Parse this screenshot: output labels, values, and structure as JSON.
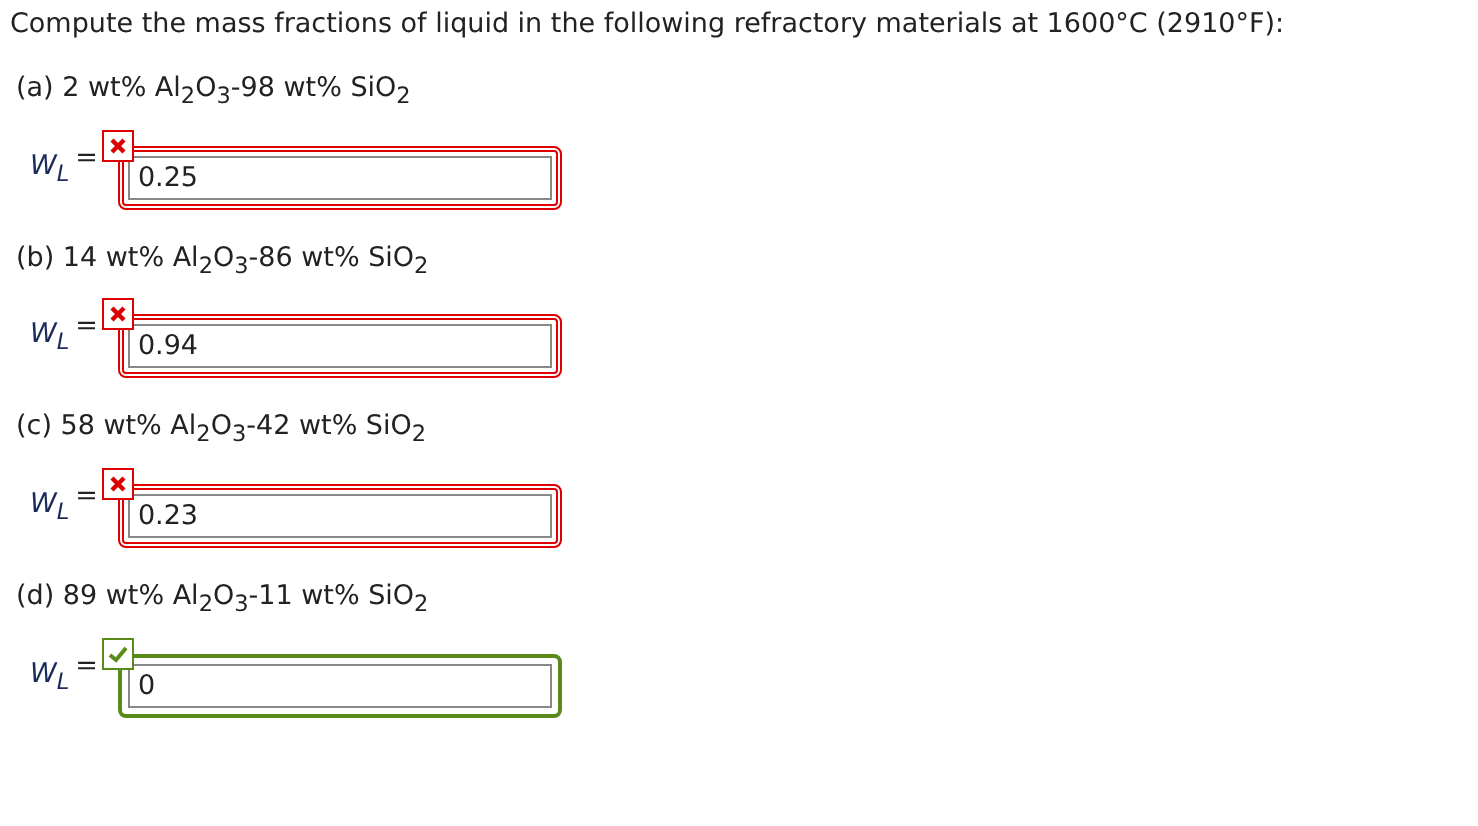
{
  "prompt": "Compute the mass fractions of liquid in the following refractory materials at 1600°C (2910°F):",
  "parts": [
    {
      "label": "(a) 2 wt% Al$_{2}$O$_{3}$-98 wt% SiO$_{2}$",
      "variable": "W$_{L}$",
      "equals": "=",
      "value": "0.25",
      "correct": false
    },
    {
      "label": "(b) 14 wt% Al$_{2}$O$_{3}$-86 wt% SiO$_{2}$",
      "variable": "W$_{L}$",
      "equals": "=",
      "value": "0.94",
      "correct": false
    },
    {
      "label": "(c) 58 wt% Al$_{2}$O$_{3}$-42 wt% SiO$_{2}$",
      "variable": "W$_{L}$",
      "equals": "=",
      "value": "0.23",
      "correct": false
    },
    {
      "label": "(d) 89 wt% Al$_{2}$O$_{3}$-11 wt% SiO$_{2}$",
      "variable": "W$_{L}$",
      "equals": "=",
      "value": "0",
      "correct": true
    }
  ]
}
